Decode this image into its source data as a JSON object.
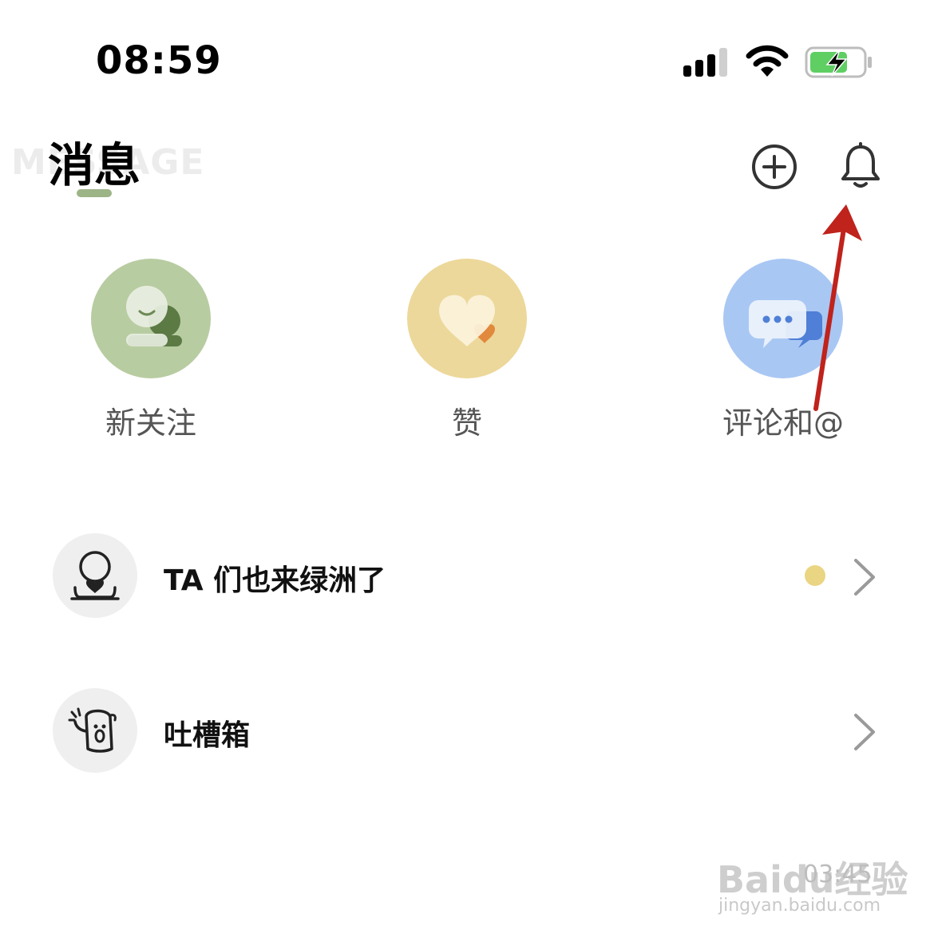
{
  "status_bar": {
    "time": "08:59"
  },
  "header": {
    "title": "消息",
    "background_text": "MESSAGE",
    "accent_color": "#9db487"
  },
  "shortcuts": [
    {
      "label": "新关注",
      "icon": "new-follower-icon",
      "color": "#b8cca1"
    },
    {
      "label": "赞",
      "icon": "like-heart-icon",
      "color": "#ecd89a"
    },
    {
      "label": "评论和@",
      "icon": "comment-bubble-icon",
      "color": "#a9c7f3"
    }
  ],
  "list": [
    {
      "label": "TA 们也来绿洲了",
      "icon": "person-heart-icon",
      "has_dot": true,
      "dot_color": "#ead583"
    },
    {
      "label": "吐槽箱",
      "icon": "ghost-shout-icon",
      "has_dot": false
    }
  ],
  "watermark": {
    "brand": "Baidu经验",
    "url": "jingyan.baidu.com",
    "number": "03:45"
  }
}
